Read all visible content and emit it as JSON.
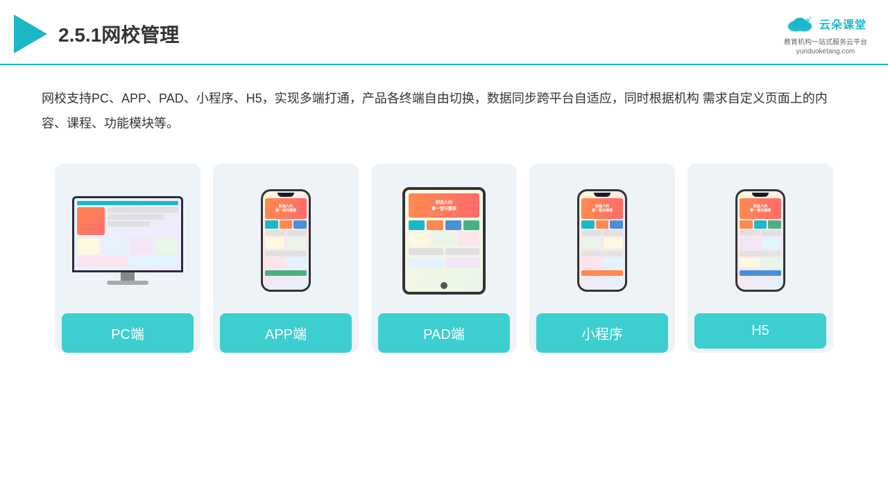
{
  "header": {
    "title": "2.5.1网校管理",
    "brand": {
      "name": "云朵课堂",
      "domain": "yunduoketang.com",
      "tagline": "教育机构一站\n式服务云平台"
    }
  },
  "description": "网校支持PC、APP、PAD、小程序、H5，实现多端打通，产品各终端自由切换，数据同步跨平台自适应，同时根据机构\n需求自定义页面上的内容、课程、功能模块等。",
  "cards": [
    {
      "id": "pc",
      "label": "PC端"
    },
    {
      "id": "app",
      "label": "APP端"
    },
    {
      "id": "pad",
      "label": "PAD端"
    },
    {
      "id": "mini",
      "label": "小程序"
    },
    {
      "id": "h5",
      "label": "H5"
    }
  ],
  "colors": {
    "accent": "#1db8c8",
    "card_bg": "#eef3f8",
    "label_bg": "#3dcfcf"
  }
}
